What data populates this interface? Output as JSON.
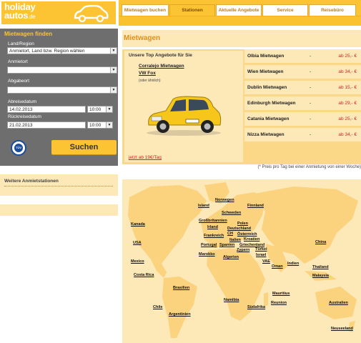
{
  "brand": {
    "logo_main": "holiday",
    "logo_second": "autos",
    "logo_tld": ".de"
  },
  "nav": {
    "tabs": [
      {
        "label": "Mietwagen buchen"
      },
      {
        "label": "Stationen"
      },
      {
        "label": "Aktuelle Angebote"
      },
      {
        "label": "Service"
      },
      {
        "label": "Reisebüro"
      }
    ],
    "active": "Stationen"
  },
  "search": {
    "title": "Mietwagen finden",
    "country_label": "Land/Region",
    "country_value": "Anmietort, Land bzw. Region wählen",
    "pickup_label": "Anmietort",
    "pickup_value": "",
    "dropoff_label": "Abgabeort",
    "dropoff_value": "",
    "pickup_date_label": "Abreisedatum",
    "pickup_date": "14.02.2013",
    "pickup_time": "10:00",
    "return_date_label": "Rückreisedatum",
    "return_date": "21.02.2013",
    "return_time": "10:00",
    "button": "Suchen",
    "badge": "TÜV"
  },
  "stations": {
    "title": "Weitere Anmietstationen"
  },
  "main": {
    "title": "Mietwagen",
    "offer_heading": "Unsere Top Angebote für Sie",
    "offer_location": "Corralejo Mietwagen",
    "offer_car": "VW Fox",
    "offer_note": "(oder ähnlich)",
    "offer_price": "jetzt ab 19€/Tag",
    "footnote": "(* Preis pro Tag bei einer Anmietung von einer Woche)"
  },
  "offers": [
    {
      "city": "Olbia Mietwagen",
      "dash": "-",
      "price": "ab 25,- €"
    },
    {
      "city": "Wien Mietwagen",
      "dash": "-",
      "price": "ab 34,- €"
    },
    {
      "city": "Dublin Mietwagen",
      "dash": "-",
      "price": "ab 15,- €"
    },
    {
      "city": "Edinburgh Mietwagen",
      "dash": "-",
      "price": "ab 29,- €"
    },
    {
      "city": "Catania Mietwagen",
      "dash": "-",
      "price": "ab 25,- €"
    },
    {
      "city": "Nizza Mietwagen",
      "dash": "-",
      "price": "ab 34,- €"
    }
  ],
  "map": {
    "countries": [
      "Norwegen",
      "Island",
      "Finnland",
      "Schweden",
      "Kanada",
      "Großbritannien",
      "Polen",
      "Irland",
      "Deutschland",
      "Frankreich",
      "CH",
      "Österreich",
      "Italien",
      "Kroatien",
      "Portugal",
      "Spanien",
      "Griechenland",
      "Türkei",
      "Zypern",
      "USA",
      "Marokko",
      "Algerien",
      "Israel",
      "China",
      "VAE",
      "Indien",
      "Mexico",
      "Oman",
      "Thailand",
      "Malaysia",
      "Costa Rica",
      "Brasilien",
      "Mauritius",
      "Namibia",
      "Reunion",
      "Chile",
      "Südafrika",
      "Australien",
      "Argentinien",
      "Neuseeland"
    ]
  },
  "colors": {
    "brand_yellow": "#fcc433",
    "panel_grey": "#6e6e6e",
    "price_red": "#d02424",
    "light_panel": "#fde8b8"
  }
}
